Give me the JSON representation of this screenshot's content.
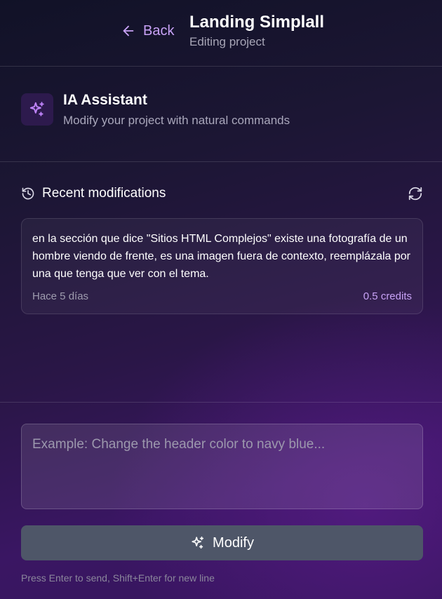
{
  "header": {
    "back_label": "Back",
    "title": "Landing Simplall",
    "subtitle": "Editing project"
  },
  "assistant": {
    "title": "IA Assistant",
    "description": "Modify your project with natural commands",
    "icon": "sparkles-icon"
  },
  "recent": {
    "title": "Recent modifications",
    "icons": {
      "history": "history-icon",
      "refresh": "refresh-icon"
    },
    "items": [
      {
        "text": "en la sección que dice \"Sitios HTML Complejos\" existe una fotografía de un hombre viendo de frente, es una imagen fuera de contexto, reemplázala por una que tenga que ver con el tema.",
        "time": "Hace 5 días",
        "credits": "0.5 credits"
      }
    ]
  },
  "composer": {
    "placeholder": "Example: Change the header color to navy blue...",
    "value": "",
    "button_label": "Modify",
    "hint": "Press Enter to send, Shift+Enter for new line"
  },
  "colors": {
    "accent": "#c8a2f6",
    "button_bg": "#4e5668",
    "icon_tile_bg": "#2d1a4d"
  }
}
